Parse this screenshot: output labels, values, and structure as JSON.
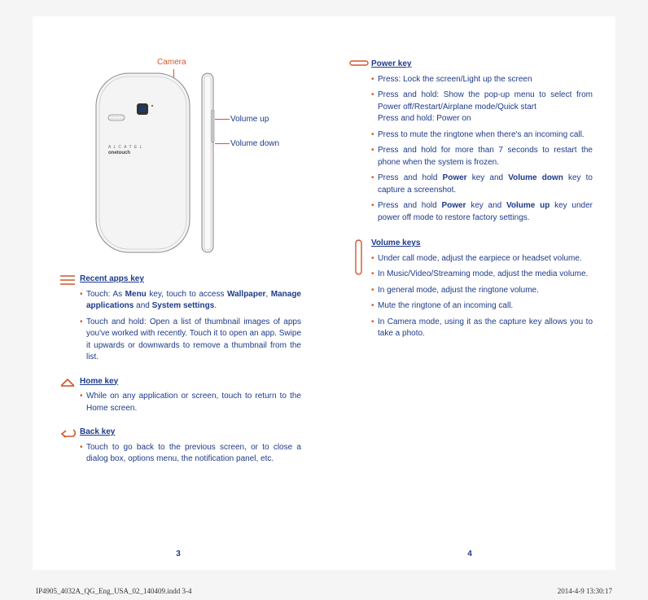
{
  "diagram": {
    "camera": "Camera",
    "volume_up": "Volume up",
    "volume_down": "Volume down",
    "brand1": "A L C A T E L",
    "brand2": "onetouch"
  },
  "left": {
    "recent": {
      "title": "Recent apps key",
      "b1_pre": "Touch:  As ",
      "b1_bold1": "Menu",
      "b1_mid1": " key, touch to access ",
      "b1_bold2": "Wallpaper",
      "b1_mid2": ", ",
      "b1_bold3": "Manage applications",
      "b1_mid3": " and ",
      "b1_bold4": "System settings",
      "b1_end": ".",
      "b2": "Touch and hold: Open a list of thumbnail images of apps you've worked with recently. Touch it to open an app. Swipe it upwards or downwards to remove a thumbnail from the list."
    },
    "home": {
      "title": "Home key",
      "b1": "While on any application or screen,  touch to return to the Home screen."
    },
    "back": {
      "title": "Back key",
      "b1": "Touch to go back to the previous screen, or to close a dialog box, options menu, the notification panel, etc."
    },
    "pagenum": "3"
  },
  "right": {
    "power": {
      "title": "Power key",
      "b1": "Press: Lock the screen/Light up the screen",
      "b2": "Press and hold: Show the pop-up menu to select from Power off/Restart/Airplane mode/Quick start\nPress and hold: Power on",
      "b3": "Press to mute the ringtone when there's an incoming call.",
      "b4": "Press and hold for more than 7 seconds to restart the phone when the system is frozen.",
      "b5_pre": "Press and hold ",
      "b5_bold1": "Power",
      "b5_mid1": " key and ",
      "b5_bold2": "Volume down",
      "b5_end": " key to capture a screenshot.",
      "b6_pre": "Press and hold ",
      "b6_bold1": "Power",
      "b6_mid1": " key and ",
      "b6_bold2": "Volume up",
      "b6_end": " key under power off mode to restore factory settings."
    },
    "volume": {
      "title": "Volume keys",
      "b1": "Under call mode, adjust the earpiece or headset volume.",
      "b2": "In Music/Video/Streaming mode, adjust the media volume.",
      "b3": "In general mode, adjust the ringtone volume.",
      "b4": "Mute the ringtone of an incoming call.",
      "b5": "In Camera mode, using it as the capture key allows you to take a photo."
    },
    "pagenum": "4"
  },
  "footer": {
    "left": "IP4905_4032A_QG_Eng_USA_02_140409.indd   3-4",
    "right": "2014-4-9   13:30:17"
  }
}
